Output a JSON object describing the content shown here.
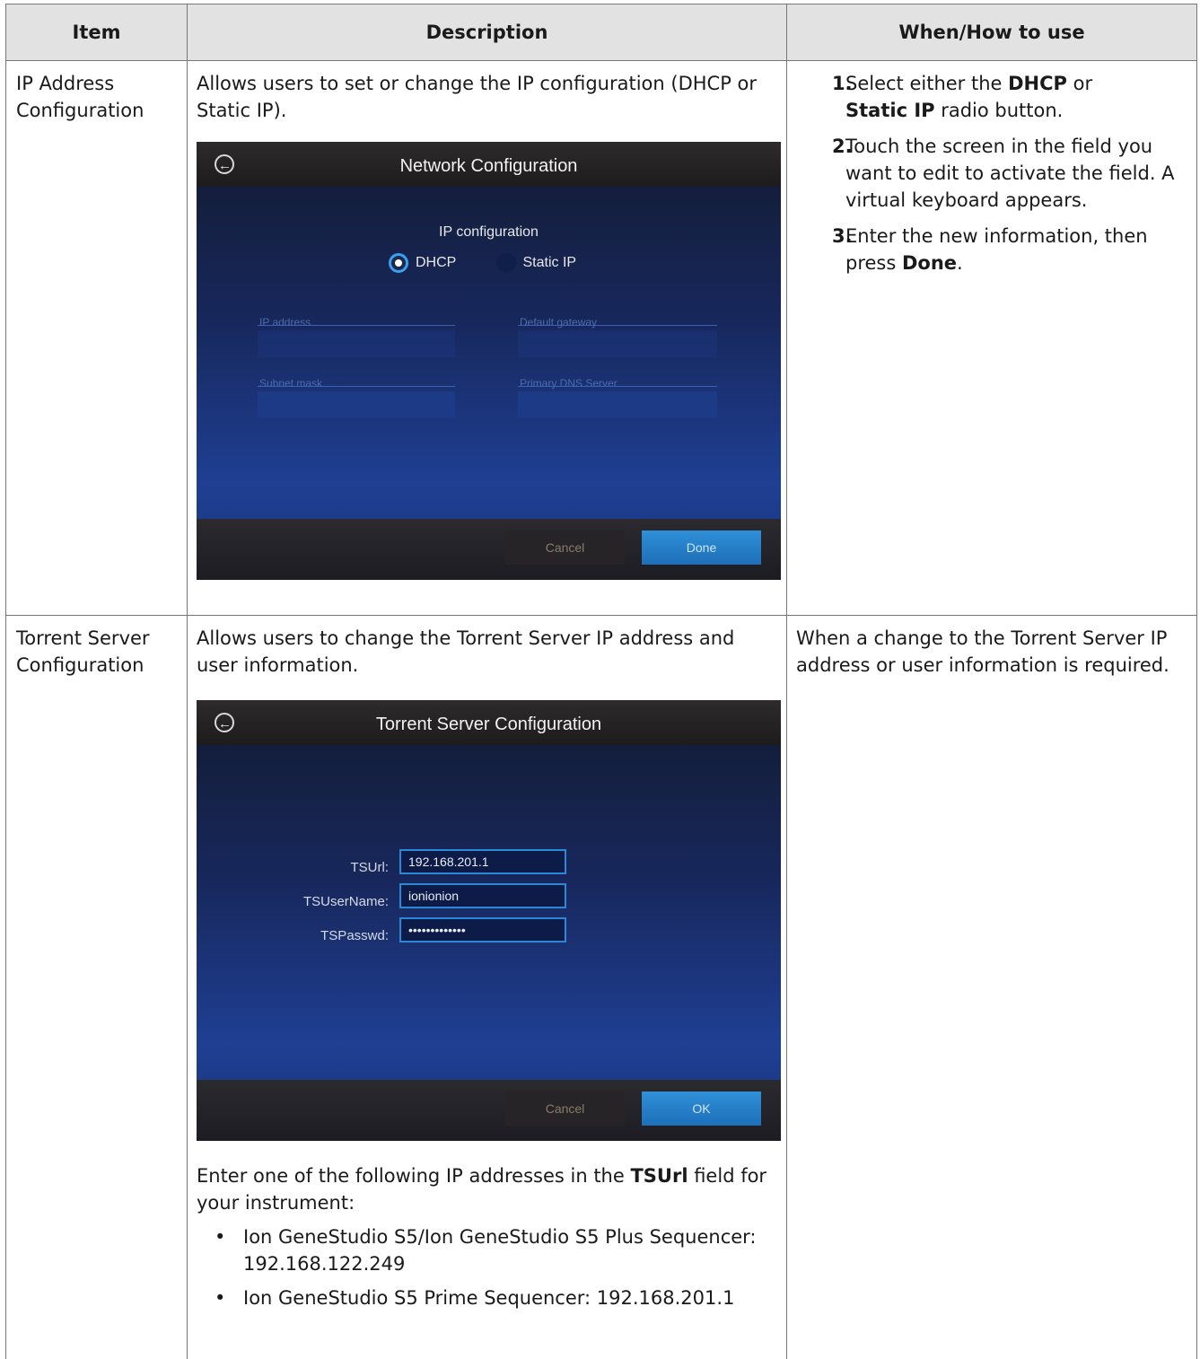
{
  "headers": {
    "item": "Item",
    "description": "Description",
    "when": "When/How to use"
  },
  "row1": {
    "item": "IP Address Configuration",
    "description": "Allows users to set or change the IP configuration (DHCP or Static IP).",
    "screen": {
      "title": "Network Configuration",
      "ip_configuration_label": "IP configuration",
      "radio_dhcp": "DHCP",
      "radio_static": "Static IP",
      "radio_selected": "DHCP",
      "field_ip_address": "IP address",
      "field_default_gateway": "Default gateway",
      "field_subnet_mask": "Subnet mask",
      "field_primary_dns": "Primary DNS Server",
      "cancel": "Cancel",
      "done": "Done"
    },
    "steps": [
      {
        "num": "1.",
        "pre": "Select either the ",
        "b1": "DHCP",
        "mid": " or ",
        "b2": "Static IP",
        "post": " radio button."
      },
      {
        "num": "2.",
        "text": "Touch the screen in the field you want to edit to activate the field. A virtual keyboard appears."
      },
      {
        "num": "3.",
        "pre": "Enter the new information, then press ",
        "b1": "Done",
        "post": "."
      }
    ]
  },
  "row2": {
    "item": "Torrent Server Configuration",
    "description": "Allows users to change the Torrent Server IP address and user information.",
    "screen": {
      "title": "Torrent Server Configuration",
      "tsurl_label": "TSUrl:",
      "tsurl_value": "192.168.201.1",
      "tsusername_label": "TSUserName:",
      "tsusername_value": "ionionion",
      "tspasswd_label": "TSPasswd:",
      "tspasswd_value": "•••••••••••••",
      "cancel": "Cancel",
      "ok": "OK"
    },
    "note_pre": "Enter one of the following IP addresses in the ",
    "note_bold": "TSUrl",
    "note_post": " field for your instrument:",
    "bullets": [
      "Ion GeneStudio S5/Ion GeneStudio S5 Plus Sequencer: 192.168.122.249",
      "Ion GeneStudio S5 Prime Sequencer: 192.168.201.1"
    ],
    "when": "When a change to the Torrent Server IP address or user information is required."
  }
}
